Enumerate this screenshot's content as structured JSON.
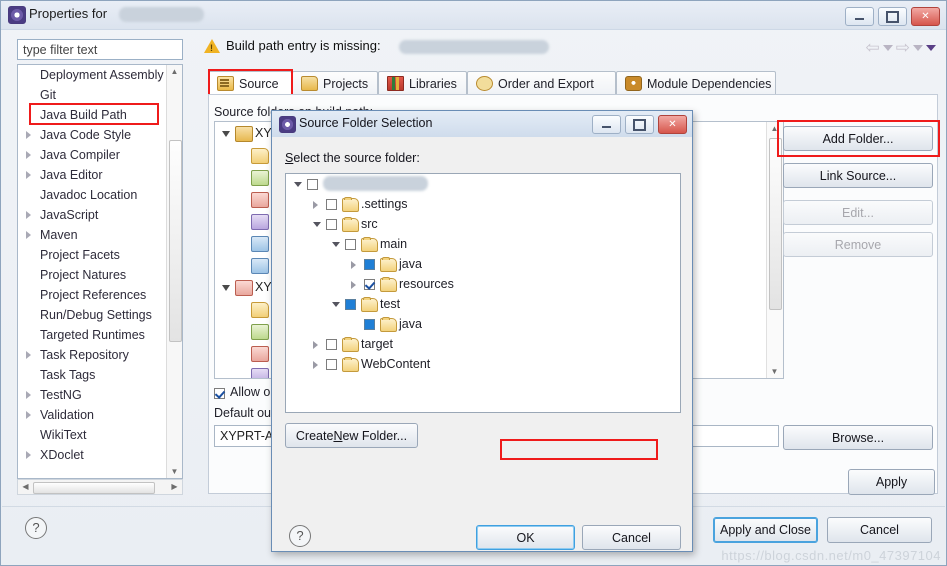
{
  "window": {
    "title": "Properties for",
    "title_icon": "eclipse-properties-icon",
    "minimize_label": "",
    "maximize_label": "",
    "close_label": "✕"
  },
  "filter": {
    "placeholder": "type filter text",
    "value": "type filter text"
  },
  "sidebar": {
    "items": [
      {
        "label": "Deployment Assembly",
        "expandable": false,
        "selected": false
      },
      {
        "label": "Git",
        "expandable": false,
        "selected": false
      },
      {
        "label": "Java Build Path",
        "expandable": false,
        "selected": true
      },
      {
        "label": "Java Code Style",
        "expandable": true,
        "selected": false
      },
      {
        "label": "Java Compiler",
        "expandable": true,
        "selected": false
      },
      {
        "label": "Java Editor",
        "expandable": true,
        "selected": false
      },
      {
        "label": "Javadoc Location",
        "expandable": false,
        "selected": false
      },
      {
        "label": "JavaScript",
        "expandable": true,
        "selected": false
      },
      {
        "label": "Maven",
        "expandable": true,
        "selected": false
      },
      {
        "label": "Project Facets",
        "expandable": false,
        "selected": false
      },
      {
        "label": "Project Natures",
        "expandable": false,
        "selected": false
      },
      {
        "label": "Project References",
        "expandable": false,
        "selected": false
      },
      {
        "label": "Run/Debug Settings",
        "expandable": false,
        "selected": false
      },
      {
        "label": "Targeted Runtimes",
        "expandable": false,
        "selected": false
      },
      {
        "label": "Task Repository",
        "expandable": true,
        "selected": false
      },
      {
        "label": "Task Tags",
        "expandable": false,
        "selected": false
      },
      {
        "label": "TestNG",
        "expandable": true,
        "selected": false
      },
      {
        "label": "Validation",
        "expandable": true,
        "selected": false
      },
      {
        "label": "WikiText",
        "expandable": false,
        "selected": false
      },
      {
        "label": "XDoclet",
        "expandable": true,
        "selected": false
      }
    ]
  },
  "warning": {
    "icon": "warning-triangle-icon",
    "text": "Build path entry is missing:"
  },
  "navigation": {
    "back_icon": "back-arrow-icon",
    "back_menu_icon": "chevron-down-icon",
    "forward_icon": "forward-arrow-icon",
    "forward_menu_icon": "chevron-down-icon",
    "menu_icon": "chevron-down-filled-icon"
  },
  "tabs": [
    {
      "label": "Source",
      "icon": "source-folder-icon",
      "active": true,
      "highlighted": true
    },
    {
      "label": "Projects",
      "icon": "projects-icon",
      "active": false
    },
    {
      "label": "Libraries",
      "icon": "libraries-icon",
      "active": false
    },
    {
      "label": "Order and Export",
      "icon": "order-export-icon",
      "active": false
    },
    {
      "label": "Module Dependencies",
      "icon": "module-dependencies-icon",
      "active": false
    }
  ],
  "source_panel": {
    "label": "Source folders on build path:",
    "entries": [
      {
        "label": "XY",
        "icon": "source-root-icon",
        "indent": 0,
        "expanded": true
      },
      {
        "label": "",
        "icon": "output-folder-icon",
        "indent": 1
      },
      {
        "label": "",
        "icon": "included-icon",
        "indent": 1
      },
      {
        "label": "",
        "icon": "excluded-icon",
        "indent": 1
      },
      {
        "label": "",
        "icon": "native-library-icon",
        "indent": 1
      },
      {
        "label": "",
        "icon": "ignore-optional-icon",
        "indent": 1
      },
      {
        "label": "",
        "icon": "javadoc-icon",
        "indent": 1
      },
      {
        "label": "XY",
        "icon": "source-root-error-icon",
        "indent": 0,
        "expanded": true
      },
      {
        "label": "",
        "icon": "output-folder-icon",
        "indent": 1
      },
      {
        "label": "",
        "icon": "included-icon",
        "indent": 1
      },
      {
        "label": "",
        "icon": "excluded-icon",
        "indent": 1
      },
      {
        "label": "",
        "icon": "native-library-icon",
        "indent": 1
      }
    ],
    "allow_checkbox_label": "Allow output folders for source folders",
    "allow_checkbox_checked": true,
    "default_output_label": "Default output folder:",
    "default_output_value": "XYPRT-A"
  },
  "side_buttons": [
    {
      "label": "Add Folder...",
      "enabled": true,
      "highlighted": true
    },
    {
      "label": "Link Source...",
      "enabled": true,
      "highlighted": false
    },
    {
      "label": "Edit...",
      "enabled": false,
      "highlighted": false
    },
    {
      "label": "Remove",
      "enabled": false,
      "highlighted": false
    }
  ],
  "browse_button": "Browse...",
  "apply_button": "Apply",
  "footer": {
    "help_icon": "help-question-icon",
    "apply_and_close": "Apply and Close",
    "cancel": "Cancel"
  },
  "dialog": {
    "title": "Source Folder Selection",
    "title_icon": "eclipse-dialog-icon",
    "prompt_prefix": "S",
    "prompt_rest": "elect the source folder:",
    "minimize_label": "",
    "maximize_label": "",
    "close_label": "✕",
    "tree": [
      {
        "label": "",
        "redacted": true,
        "depth": 0,
        "twisty": "down",
        "checkbox": "empty",
        "folder": false,
        "highlighted": false
      },
      {
        "label": ".settings",
        "redacted": false,
        "depth": 1,
        "twisty": "right",
        "checkbox": "empty",
        "folder": true,
        "highlighted": false
      },
      {
        "label": "src",
        "redacted": false,
        "depth": 1,
        "twisty": "down",
        "checkbox": "empty",
        "folder": true,
        "highlighted": false
      },
      {
        "label": "main",
        "redacted": false,
        "depth": 2,
        "twisty": "down",
        "checkbox": "empty",
        "folder": true,
        "highlighted": false
      },
      {
        "label": "java",
        "redacted": false,
        "depth": 3,
        "twisty": "right",
        "checkbox": "grey",
        "folder": true,
        "highlighted": false
      },
      {
        "label": "resources",
        "redacted": false,
        "depth": 3,
        "twisty": "right",
        "checkbox": "checked",
        "folder": true,
        "highlighted": true
      },
      {
        "label": "test",
        "redacted": false,
        "depth": 2,
        "twisty": "down",
        "checkbox": "grey",
        "folder": true,
        "highlighted": false
      },
      {
        "label": "java",
        "redacted": false,
        "depth": 3,
        "twisty": "none",
        "checkbox": "grey",
        "folder": true,
        "highlighted": false
      },
      {
        "label": "target",
        "redacted": false,
        "depth": 1,
        "twisty": "right",
        "checkbox": "empty",
        "folder": true,
        "highlighted": false
      },
      {
        "label": "WebContent",
        "redacted": false,
        "depth": 1,
        "twisty": "right",
        "checkbox": "empty",
        "folder": true,
        "highlighted": false
      }
    ],
    "create_new_folder": "Create New Folder...",
    "create_new_folder_prefix": "Create ",
    "create_new_folder_mnemonic": "N",
    "create_new_folder_suffix": "ew Folder...",
    "help_icon": "help-question-icon",
    "ok": "OK",
    "cancel": "Cancel"
  },
  "watermark": "https://blog.csdn.net/m0_47397104",
  "colors": {
    "highlight_red": "#ef1b1b",
    "accent_blue": "#3fa0e0",
    "folder_yellow": "#f3d27d",
    "checkbox_blue": "#1f7fd6"
  }
}
